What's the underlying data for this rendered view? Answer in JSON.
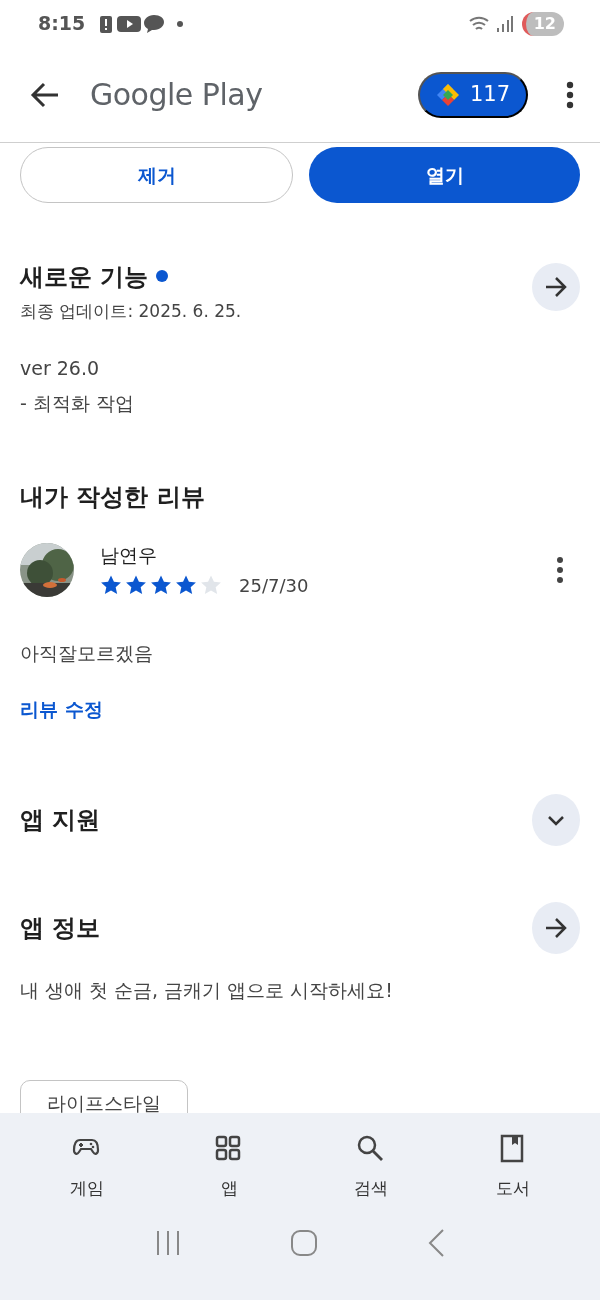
{
  "status_bar": {
    "time": "8:15",
    "notification_count": "12"
  },
  "header": {
    "title": "Google Play",
    "points": "117"
  },
  "actions": [
    {
      "label": "제거",
      "kind": "outline"
    },
    {
      "label": "열기",
      "kind": "filled"
    }
  ],
  "whats_new": {
    "title": "새로운 기능",
    "new_dot": true,
    "updated": "최종 업데이트: 2025. 6. 25.",
    "notes": [
      "ver 26.0",
      "- 최적화 작업"
    ]
  },
  "my_review": {
    "title": "내가 작성한 리뷰",
    "author": "남연우",
    "stars": 4,
    "date": "25/7/30",
    "text": "아직잘모르겠음",
    "edit_link": "리뷰 수정"
  },
  "sections": [
    {
      "title": "앱 지원",
      "kind": "expand"
    },
    {
      "title": "앱 정보",
      "kind": "arrow",
      "description": "내 생애 첫 순금, 금캐기 앱으로 시작하세요!"
    }
  ],
  "tags": [
    "라이프스타일"
  ],
  "bottom_nav": [
    {
      "label": "게임",
      "kind": "games"
    },
    {
      "label": "앱",
      "kind": "apps"
    },
    {
      "label": "검색",
      "kind": "search"
    },
    {
      "label": "도서",
      "kind": "books"
    }
  ]
}
